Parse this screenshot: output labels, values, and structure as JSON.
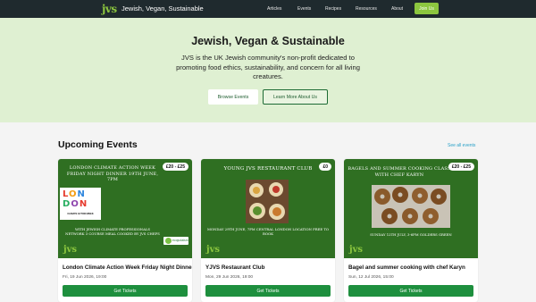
{
  "nav": {
    "logo": "jvs",
    "brand": "Jewish, Vegan, Sustainable",
    "links": [
      "Articles",
      "Events",
      "Recipes",
      "Resources",
      "About"
    ],
    "join_label": "Join Us"
  },
  "hero": {
    "title": "Jewish, Vegan & Sustainable",
    "description": "JVS is the UK Jewish community's non-profit dedicated to promoting food ethics, sustainability, and concern for all living creatures.",
    "browse_label": "Browse Events",
    "learn_label": "Learn More About Us"
  },
  "events": {
    "title": "Upcoming Events",
    "see_all": "See all events",
    "cards": [
      {
        "poster_heading": "LONDON CLIMATE ACTION WEEK FRIDAY NIGHT DINNER 19TH JUNE, 7PM",
        "poster_sub": "WITH JEWISH CLIMATE PROFESSIONALS NETWORK 3 COURSE MEAL COOKED BY JVS CHEFS",
        "london_letters": "LON DON",
        "london_sub": "CLIMATE ACTION WEEK",
        "badge_text": "ecojudaism",
        "poster_logo": "jvs",
        "price": "£20 - £25",
        "title": "London Climate Action Week Friday Night Dinner",
        "date": "Fri, 19 Jun 2026, 19:00",
        "button": "Get Tickets"
      },
      {
        "poster_heading": "YOUNG JVS RESTAURANT CLUB",
        "poster_sub": "MONDAY 29TH JUNE, 7PM CENTRAL LONDON LOCATION FREE TO BOOK",
        "poster_logo": "jvs",
        "price": "£0",
        "title": "YJVS Restaurant Club",
        "date": "Mon, 29 Jun 2026, 19:00",
        "button": "Get Tickets"
      },
      {
        "poster_heading": "BAGELS AND SUMMER COOKING CLASS WITH CHEF KARYN",
        "poster_sub": "SUNDAY 12TH JULY, 3-6PM GOLDERS GREEN",
        "poster_logo": "jvs",
        "price": "£20 - £25",
        "title": "Bagel and summer cooking with chef Karyn",
        "date": "Sun, 12 Jul 2026, 15:00",
        "button": "Get Tickets"
      }
    ]
  },
  "colors": {
    "nav_bg": "#1f2a2e",
    "accent": "#8cc63f",
    "hero_bg": "#dff0d2",
    "button_green": "#1e8f3e",
    "poster_green": "#2f6f22",
    "link_blue": "#2aa1c8"
  }
}
